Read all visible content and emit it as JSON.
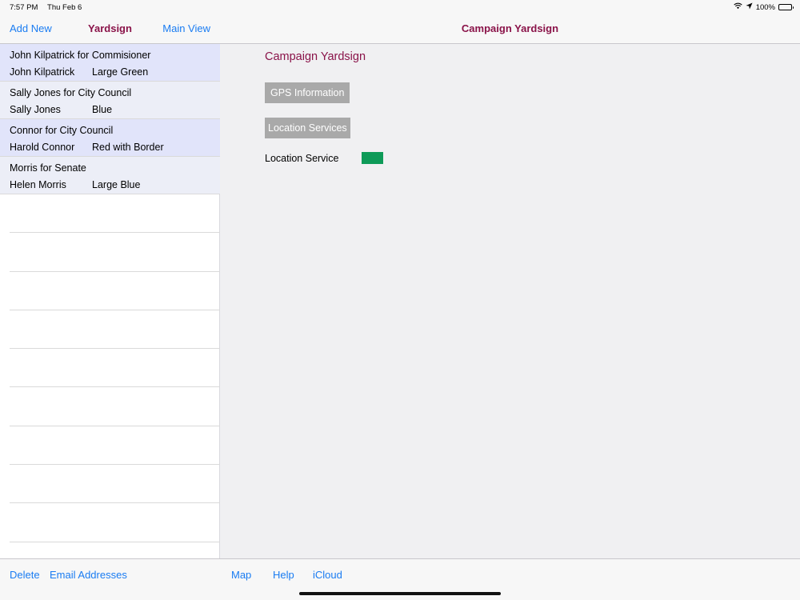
{
  "status_bar": {
    "time": "7:57 PM",
    "date": "Thu Feb 6",
    "battery": "100%",
    "battery_level": 1.0,
    "icons": [
      "wifi-icon",
      "location-arrow-icon",
      "battery-icon"
    ]
  },
  "master": {
    "nav": {
      "left_button": "Add New",
      "title": "Yardsign",
      "right_button": "Main View"
    },
    "items": [
      {
        "title": "John Kilpatrick for Commisioner",
        "name": "John Kilpatrick",
        "sign": "Large Green"
      },
      {
        "title": "Sally Jones for City Council",
        "name": "Sally Jones",
        "sign": "Blue"
      },
      {
        "title": "Connor for City Council",
        "name": "Harold Connor",
        "sign": "Red with Border"
      },
      {
        "title": "Morris for Senate",
        "name": "Helen Morris",
        "sign": "Large Blue"
      }
    ],
    "toolbar": {
      "delete": "Delete",
      "email": "Email Addresses"
    }
  },
  "detail": {
    "nav_title": "Campaign Yardsign",
    "heading": "Campaign Yardsign",
    "gps_button": "GPS Information",
    "location_services_button": "Location Services",
    "location_service_label": "Location Service",
    "location_service_status_color": "#0e9a58",
    "toolbar": {
      "map": "Map",
      "help": "Help",
      "icloud": "iCloud"
    }
  },
  "colors": {
    "accent": "#1a7cf2",
    "brand": "#8a1349",
    "button_gray": "#a9a9a9"
  }
}
